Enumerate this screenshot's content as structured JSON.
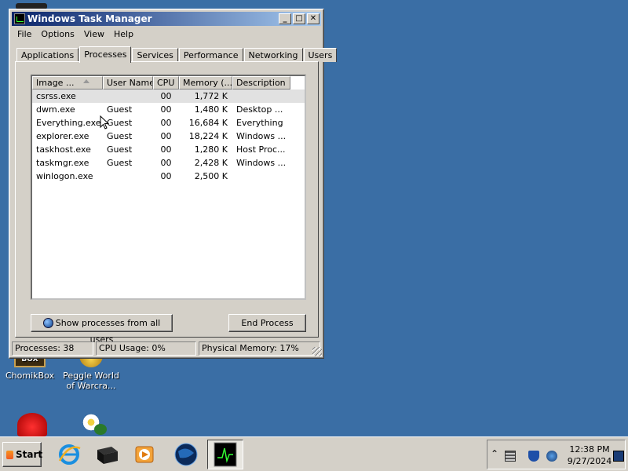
{
  "window": {
    "title": "Windows Task Manager",
    "buttons": {
      "minimize": "_",
      "maximize": "□",
      "close": "✕"
    }
  },
  "menu": [
    "File",
    "Options",
    "View",
    "Help"
  ],
  "tabs": [
    "Applications",
    "Processes",
    "Services",
    "Performance",
    "Networking",
    "Users"
  ],
  "active_tab": "Processes",
  "columns": [
    "Image ...",
    "User Name",
    "CPU",
    "Memory (...",
    "Description"
  ],
  "processes": [
    {
      "image": "csrss.exe",
      "user": "",
      "cpu": "00",
      "memory": "1,772 K",
      "description": ""
    },
    {
      "image": "dwm.exe",
      "user": "Guest",
      "cpu": "00",
      "memory": "1,480 K",
      "description": "Desktop ..."
    },
    {
      "image": "Everything.exe",
      "user": "Guest",
      "cpu": "00",
      "memory": "16,684 K",
      "description": "Everything"
    },
    {
      "image": "explorer.exe",
      "user": "Guest",
      "cpu": "00",
      "memory": "18,224 K",
      "description": "Windows ..."
    },
    {
      "image": "taskhost.exe",
      "user": "Guest",
      "cpu": "00",
      "memory": "1,280 K",
      "description": "Host Proc..."
    },
    {
      "image": "taskmgr.exe",
      "user": "Guest",
      "cpu": "00",
      "memory": "2,428 K",
      "description": "Windows ..."
    },
    {
      "image": "winlogon.exe",
      "user": "",
      "cpu": "00",
      "memory": "2,500 K",
      "description": ""
    }
  ],
  "buttons": {
    "show_all": "Show processes from all users",
    "end_process": "End Process"
  },
  "status": {
    "processes": "Processes: 38",
    "cpu": "CPU Usage: 0%",
    "memory": "Physical Memory: 17%"
  },
  "desktop_icons": [
    {
      "label": "ChomikBox"
    },
    {
      "label": "Peggle World of Warcra..."
    }
  ],
  "taskbar": {
    "start": "Start",
    "clock_time": "12:38 PM",
    "clock_date": "9/27/2024",
    "apps": [
      "internet-explorer-icon",
      "drive-icon",
      "media-player-icon",
      "globe-icon",
      "task-manager-icon"
    ]
  }
}
